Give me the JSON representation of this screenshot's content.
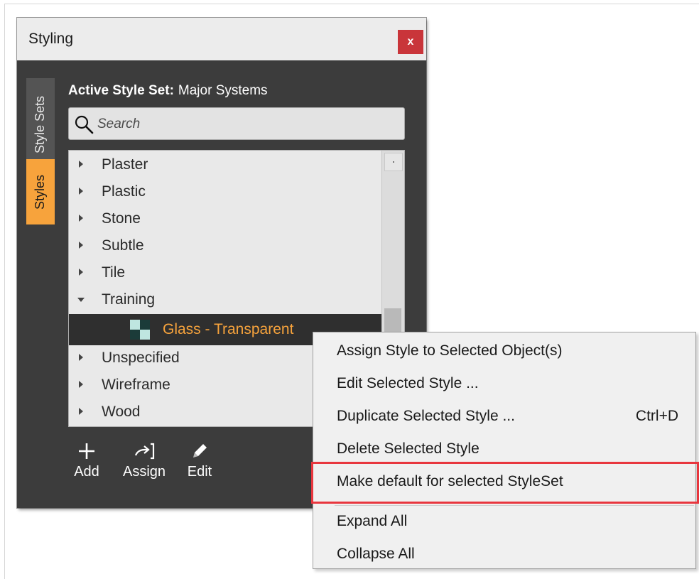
{
  "window": {
    "title": "Styling",
    "close_label": "x"
  },
  "tabs": [
    {
      "label": "Style Sets",
      "active": false
    },
    {
      "label": "Styles",
      "active": true
    }
  ],
  "active_style_set": {
    "label": "Active Style Set:",
    "value": "Major Systems"
  },
  "search": {
    "placeholder": "Search",
    "value": ""
  },
  "tree": {
    "items": [
      {
        "label": "Plaster",
        "expanded": false
      },
      {
        "label": "Plastic",
        "expanded": false
      },
      {
        "label": "Stone",
        "expanded": false
      },
      {
        "label": "Subtle",
        "expanded": false
      },
      {
        "label": "Tile",
        "expanded": false
      },
      {
        "label": "Training",
        "expanded": true
      },
      {
        "label": "Glass - Transparent",
        "child": true,
        "selected": true
      },
      {
        "label": "Unspecified",
        "expanded": false
      },
      {
        "label": "Wireframe",
        "expanded": false
      },
      {
        "label": "Wood",
        "expanded": false
      }
    ]
  },
  "toolbar": {
    "add_label": "Add",
    "assign_label": "Assign",
    "edit_label": "Edit"
  },
  "context_menu": {
    "items": [
      {
        "label": "Assign Style to Selected Object(s)",
        "shortcut": ""
      },
      {
        "label": "Edit Selected Style ...",
        "shortcut": ""
      },
      {
        "label": "Duplicate Selected Style ...",
        "shortcut": "Ctrl+D"
      },
      {
        "label": "Delete Selected Style",
        "shortcut": ""
      },
      {
        "label": "Make default for selected StyleSet",
        "shortcut": "",
        "highlighted": true
      },
      {
        "label": "Expand All",
        "shortcut": ""
      },
      {
        "label": "Collapse All",
        "shortcut": ""
      }
    ]
  },
  "colors": {
    "accent": "#f7a33c",
    "panel_bg": "#3c3c3c",
    "highlight_border": "#e8363e",
    "close_button": "#c9353a"
  }
}
